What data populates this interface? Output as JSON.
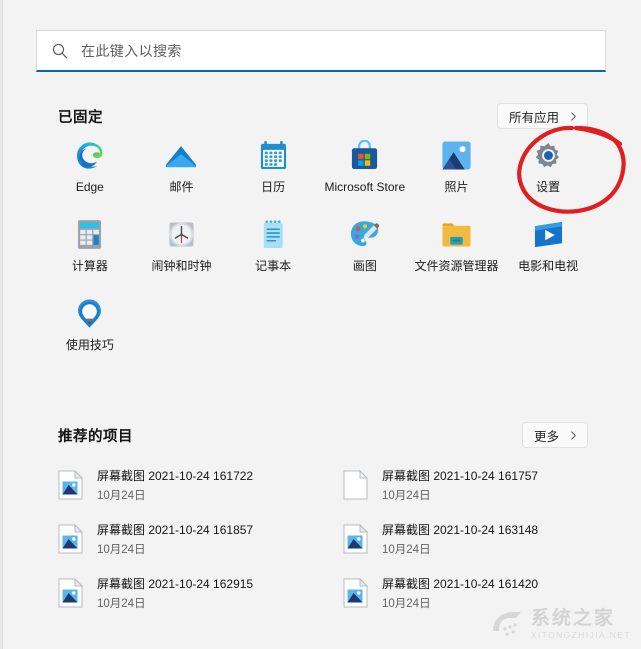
{
  "search": {
    "placeholder": "在此键入以搜索",
    "icon": "search-icon",
    "underline_color": "#0067b8"
  },
  "pinned": {
    "title": "已固定",
    "all_apps_label": "所有应用",
    "all_apps_chevron": "chevron-right-icon",
    "apps": [
      {
        "label": "Edge",
        "icon": "edge-icon"
      },
      {
        "label": "邮件",
        "icon": "mail-icon"
      },
      {
        "label": "日历",
        "icon": "calendar-icon"
      },
      {
        "label": "Microsoft Store",
        "icon": "microsoft-store-icon"
      },
      {
        "label": "照片",
        "icon": "photos-icon"
      },
      {
        "label": "设置",
        "icon": "settings-gear-icon"
      },
      {
        "label": "计算器",
        "icon": "calculator-icon"
      },
      {
        "label": "闹钟和时钟",
        "icon": "alarms-clock-icon"
      },
      {
        "label": "记事本",
        "icon": "notepad-icon"
      },
      {
        "label": "画图",
        "icon": "paint-icon"
      },
      {
        "label": "文件资源管理器",
        "icon": "file-explorer-icon"
      },
      {
        "label": "电影和电视",
        "icon": "movies-tv-icon"
      },
      {
        "label": "使用技巧",
        "icon": "tips-lightbulb-icon"
      }
    ]
  },
  "recommended": {
    "title": "推荐的项目",
    "more_label": "更多",
    "more_chevron": "chevron-right-icon",
    "items": [
      {
        "name": "屏幕截图 2021-10-24 161722",
        "date": "10月24日",
        "icon": "image-file-icon"
      },
      {
        "name": "屏幕截图 2021-10-24 161757",
        "date": "10月24日",
        "icon": "blank-file-icon"
      },
      {
        "name": "屏幕截图 2021-10-24 161857",
        "date": "10月24日",
        "icon": "image-file-icon"
      },
      {
        "name": "屏幕截图 2021-10-24 163148",
        "date": "10月24日",
        "icon": "image-file-icon"
      },
      {
        "name": "屏幕截图 2021-10-24 162915",
        "date": "10月24日",
        "icon": "image-file-icon"
      },
      {
        "name": "屏幕截图 2021-10-24 161420",
        "date": "10月24日",
        "icon": "image-file-icon"
      }
    ]
  },
  "annotation": {
    "type": "hand-drawn-circle",
    "target": "设置",
    "color": "#e02020"
  },
  "watermark": {
    "cn": "系统之家",
    "en": "XITONGZHIJIA.NET"
  },
  "colors": {
    "background": "#f3f3f3",
    "accent": "#0067b8",
    "annotation": "#e02020"
  }
}
